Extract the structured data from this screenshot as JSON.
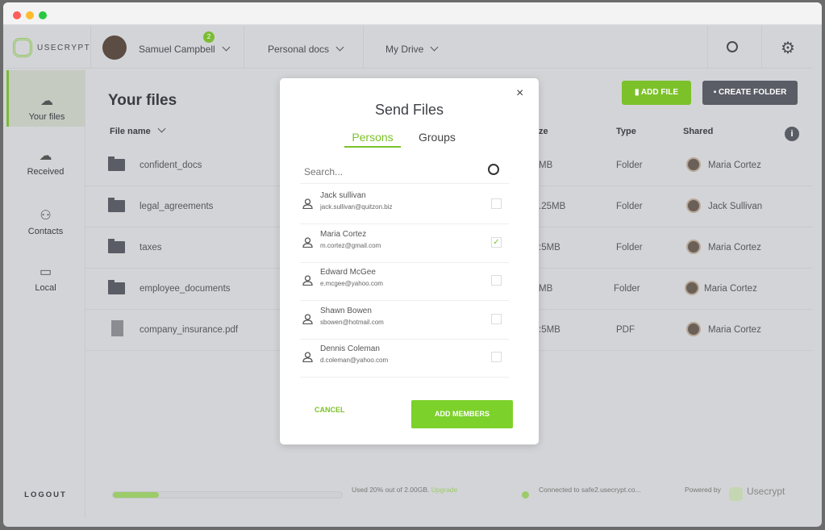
{
  "brand": {
    "name": "USECRYPT",
    "accent": "#7cc12a"
  },
  "header": {
    "user": "Samuel Campbell",
    "badge": "2",
    "menu1": "Personal docs",
    "menu2": "My Drive"
  },
  "sidebar": {
    "items": [
      {
        "label": "Your files",
        "icon": "cloud-lock-icon"
      },
      {
        "label": "Received",
        "icon": "cloud-download-icon"
      },
      {
        "label": "Contacts",
        "icon": "contacts-icon"
      },
      {
        "label": "Local",
        "icon": "monitor-icon"
      }
    ],
    "logout": "LOGOUT"
  },
  "main": {
    "title": "Your files",
    "add_file": "ADD FILE",
    "create_folder": "CREATE FOLDER",
    "columns": {
      "name": "File name",
      "size": "ze",
      "type": "Type",
      "shared": "Shared"
    },
    "rows": [
      {
        "name": "confident_docs",
        "size": "MB",
        "type": "Folder",
        "shared": "Maria Cortez",
        "icon": "folder-icon"
      },
      {
        "name": "legal_agreements",
        "size": ".25MB",
        "type": "Folder",
        "shared": "Jack Sullivan",
        "icon": "folder-icon"
      },
      {
        "name": "taxes",
        "size": ":5MB",
        "type": "Folder",
        "shared": "Maria Cortez",
        "icon": "folder-icon"
      },
      {
        "name": "employee_documents",
        "size": "MB",
        "type": "Folder",
        "shared": "Maria Cortez",
        "icon": "folder-icon"
      },
      {
        "name": "company_insurance.pdf",
        "size": ":5MB",
        "type": "PDF",
        "shared": "Maria Cortez",
        "icon": "file-icon"
      }
    ]
  },
  "footer": {
    "usage": "Used 20% out of 2.00GB.",
    "upgrade": "Upgrade",
    "usage_percent": 20,
    "connected": "Connected to safe2.usecrypt.co...",
    "powered": "Powered by",
    "powered_brand": "Usecrypt"
  },
  "modal": {
    "title": "Send Files",
    "tabs": [
      "Persons",
      "Groups"
    ],
    "search_placeholder": "Search...",
    "cancel": "CANCEL",
    "add": "ADD MEMBERS",
    "persons": [
      {
        "name": "Jack sullivan",
        "email": "jack.sullivan@quitzon.biz",
        "checked": false
      },
      {
        "name": "Maria Cortez",
        "email": "m.cortez@gmail.com",
        "checked": true
      },
      {
        "name": "Edward McGee",
        "email": "e.mcgee@yahoo.com",
        "checked": false
      },
      {
        "name": "Shawn Bowen",
        "email": "sbowen@hotmail.com",
        "checked": false
      },
      {
        "name": "Dennis Coleman",
        "email": "d.coleman@yahoo.com",
        "checked": false
      }
    ]
  }
}
